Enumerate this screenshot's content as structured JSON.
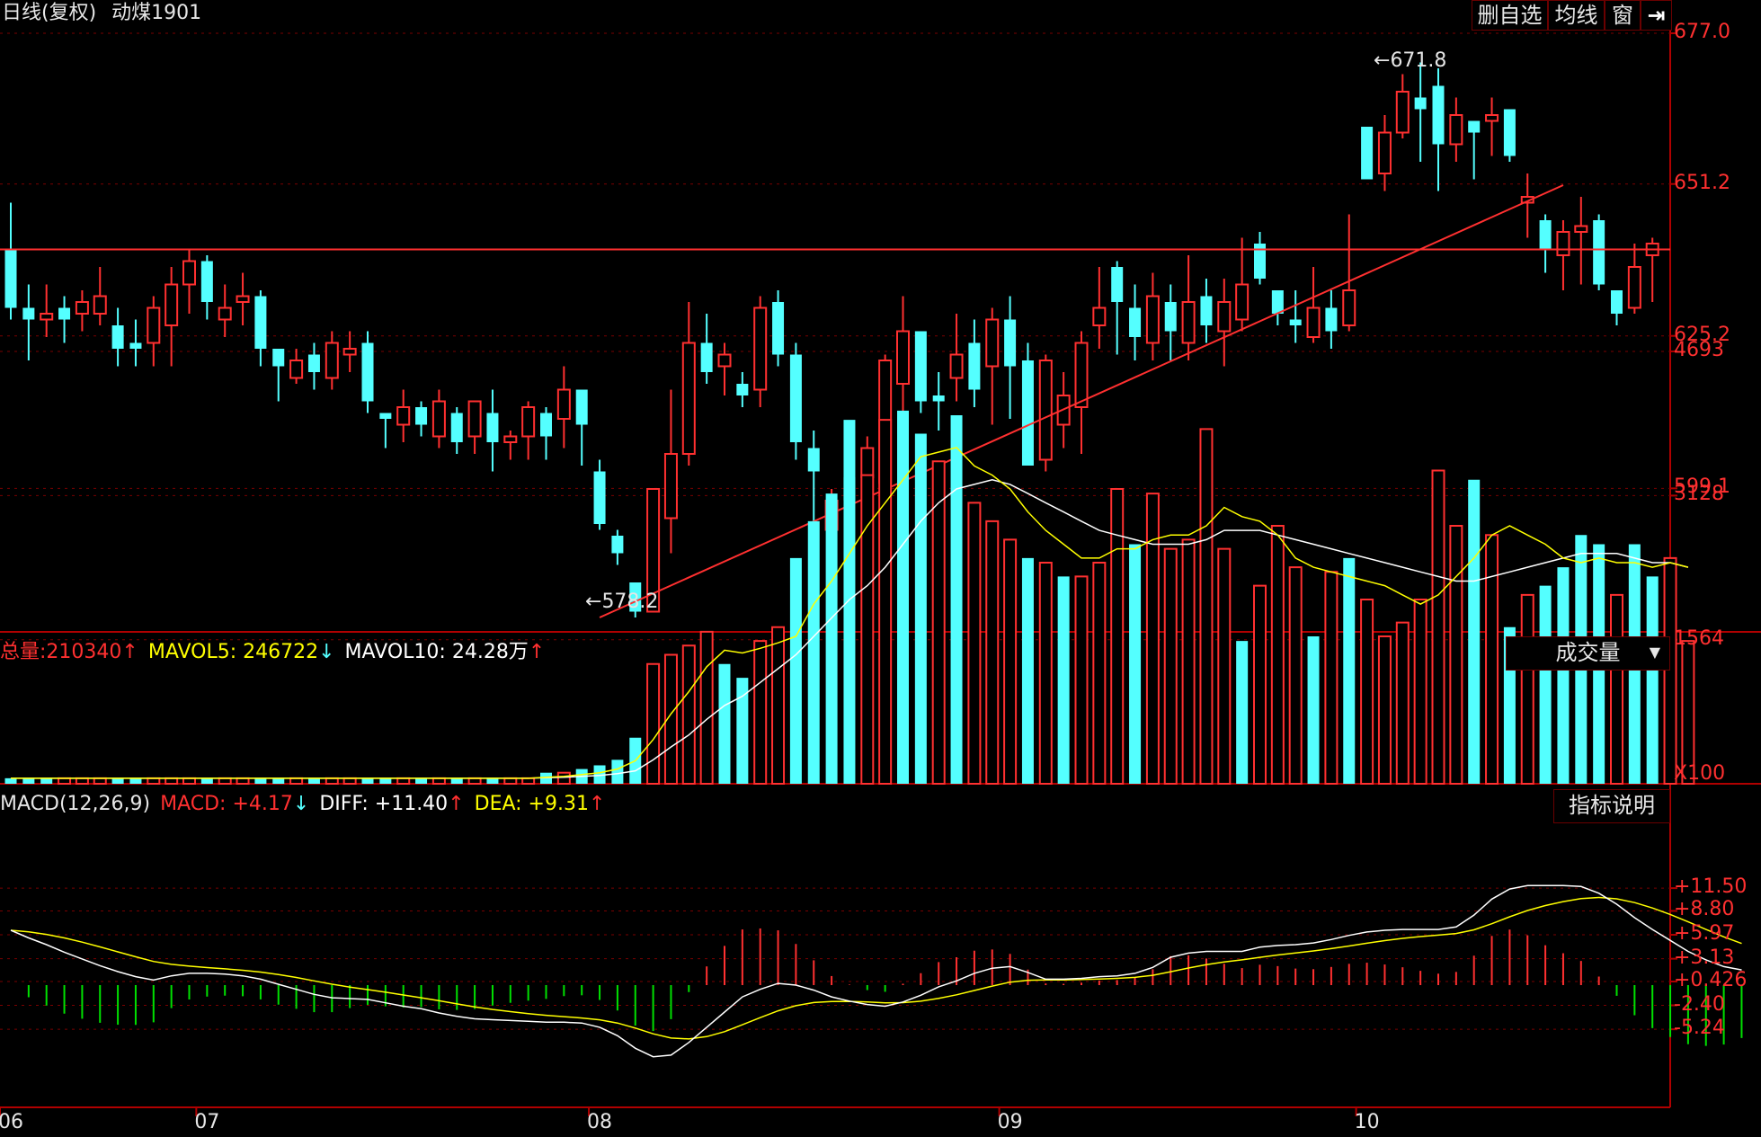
{
  "header": {
    "title": "日线(复权)",
    "symbol": "动煤1901",
    "buttons": [
      {
        "id": "delete-watchlist",
        "label": "删自选"
      },
      {
        "id": "moving-average",
        "label": "均线"
      },
      {
        "id": "window",
        "label": "窗"
      },
      {
        "id": "collapse",
        "label": "⇥"
      }
    ]
  },
  "colors": {
    "up": "#ff3030",
    "down": "#54ffff",
    "grid": "#7a0000",
    "axis": "#b00000",
    "ma5": "#ffff00",
    "ma10": "#ffffff",
    "dea": "#ffff00",
    "diff": "#ffffff",
    "macd_pos": "#ff3030",
    "macd_neg": "#00e000",
    "text": "#e6e6e6"
  },
  "price_panel": {
    "y_ticks": [
      "677.0",
      "651.2",
      "625.2",
      "599.1"
    ],
    "high_label": "671.8",
    "low_label": "578.2",
    "horizontal_line_price": 640,
    "trendline": {
      "from": {
        "index": 33,
        "price": 577
      },
      "to": {
        "index": 87,
        "price": 651
      }
    }
  },
  "volume_panel": {
    "legend": {
      "total_label": "总量:",
      "total": "210340",
      "ma5_label": "MAVOL5:",
      "ma5": "246722",
      "ma10_label": "MAVOL10:",
      "ma10": "24.28万"
    },
    "selector": "成交量",
    "y_ticks": [
      "4693",
      "3128",
      "1564"
    ],
    "unit": "X100"
  },
  "macd_panel": {
    "legend": {
      "name": "MACD(12,26,9)",
      "macd_label": "MACD:",
      "macd": "+4.17",
      "diff_label": "DIFF:",
      "diff": "+11.40",
      "dea_label": "DEA:",
      "dea": "+9.31"
    },
    "help_button": "指标说明",
    "y_ticks": [
      "+11.50",
      "+8.80",
      "+5.97",
      "+3.13",
      "+0.426",
      "-2.40",
      "-5.24"
    ]
  },
  "x_axis": {
    "labels": [
      {
        "text": "06",
        "index": 0
      },
      {
        "text": "07",
        "index": 11
      },
      {
        "text": "08",
        "index": 33
      },
      {
        "text": "09",
        "index": 56
      },
      {
        "text": "10",
        "index": 76
      }
    ]
  },
  "chart_data": {
    "type": "candlestick",
    "candles": [
      [
        640,
        630,
        648,
        628
      ],
      [
        630,
        628,
        634,
        621
      ],
      [
        628,
        629,
        634,
        625
      ],
      [
        630,
        628,
        632,
        624
      ],
      [
        629,
        631,
        633,
        626
      ],
      [
        629,
        632,
        637,
        627
      ],
      [
        627,
        623,
        630,
        620
      ],
      [
        624,
        623,
        628,
        620
      ],
      [
        624,
        630,
        632,
        620
      ],
      [
        627,
        634,
        637,
        620
      ],
      [
        634,
        638,
        640,
        629
      ],
      [
        638,
        631,
        639,
        628
      ],
      [
        628,
        630,
        634,
        625
      ],
      [
        631,
        632,
        636,
        627
      ],
      [
        632,
        623,
        633,
        620
      ],
      [
        623,
        620,
        623,
        614
      ],
      [
        618,
        621,
        623,
        617
      ],
      [
        622,
        619,
        624,
        616
      ],
      [
        618,
        624,
        626,
        616
      ],
      [
        622,
        623,
        626,
        619
      ],
      [
        624,
        614,
        626,
        612
      ],
      [
        612,
        611,
        612,
        606
      ],
      [
        610,
        613,
        616,
        607
      ],
      [
        613,
        610,
        614,
        608
      ],
      [
        608,
        614,
        616,
        606
      ],
      [
        612,
        607,
        613,
        605
      ],
      [
        608,
        614,
        614,
        605
      ],
      [
        612,
        607,
        616,
        602
      ],
      [
        607,
        608,
        609,
        604
      ],
      [
        608,
        613,
        614,
        604
      ],
      [
        612,
        608,
        613,
        604
      ],
      [
        611,
        616,
        620,
        606
      ],
      [
        616,
        610,
        616,
        603
      ],
      [
        602,
        593,
        604,
        592
      ],
      [
        591,
        588,
        592,
        586
      ],
      [
        583,
        578,
        583,
        577
      ],
      [
        578,
        599,
        599,
        578
      ],
      [
        594,
        605,
        616,
        588
      ],
      [
        605,
        624,
        631,
        603
      ],
      [
        624,
        619,
        629,
        617
      ],
      [
        620,
        622,
        624,
        615
      ],
      [
        617,
        615,
        619,
        613
      ],
      [
        616,
        630,
        632,
        613
      ],
      [
        631,
        622,
        633,
        620
      ],
      [
        622,
        607,
        624,
        604
      ],
      [
        606,
        602,
        609,
        590
      ],
      [
        592,
        597,
        599,
        590
      ],
      [
        601,
        597,
        604,
        584
      ],
      [
        601,
        606,
        608,
        599
      ],
      [
        600,
        621,
        622,
        595
      ],
      [
        617,
        626,
        632,
        609
      ],
      [
        626,
        614,
        626,
        612
      ],
      [
        615,
        614,
        619,
        609
      ],
      [
        618,
        622,
        629,
        614
      ],
      [
        624,
        616,
        628,
        613
      ],
      [
        620,
        628,
        630,
        610
      ],
      [
        628,
        620,
        632,
        611
      ],
      [
        621,
        603,
        624,
        603
      ],
      [
        604,
        621,
        622,
        602
      ],
      [
        610,
        615,
        619,
        606
      ],
      [
        613,
        624,
        626,
        605
      ],
      [
        627,
        630,
        637,
        623
      ],
      [
        637,
        631,
        638,
        622
      ],
      [
        630,
        625,
        634,
        621
      ],
      [
        624,
        632,
        636,
        621
      ],
      [
        631,
        626,
        634,
        621
      ],
      [
        624,
        631,
        639,
        621
      ],
      [
        632,
        627,
        635,
        624
      ],
      [
        626,
        631,
        635,
        620
      ],
      [
        628,
        634,
        642,
        626
      ],
      [
        641,
        635,
        643,
        634
      ],
      [
        633,
        629,
        633,
        627
      ],
      [
        628,
        627,
        633,
        624
      ],
      [
        625,
        630,
        637,
        624
      ],
      [
        630,
        626,
        633,
        623
      ],
      [
        627,
        633,
        646,
        626
      ],
      [
        661,
        652,
        656,
        655
      ],
      [
        653,
        660,
        663,
        650
      ],
      [
        660,
        667,
        670,
        659
      ],
      [
        666,
        664,
        672,
        655
      ],
      [
        668,
        658,
        671,
        650
      ],
      [
        658,
        663,
        666,
        655
      ],
      [
        662,
        660,
        661,
        652
      ],
      [
        662,
        663,
        666,
        656
      ],
      [
        664,
        656,
        664,
        655
      ],
      [
        648,
        649,
        653,
        642
      ],
      [
        645,
        640,
        646,
        636
      ],
      [
        639,
        643,
        645,
        633
      ],
      [
        643,
        644,
        649,
        634
      ],
      [
        645,
        634,
        646,
        633
      ],
      [
        633,
        629,
        631,
        627
      ],
      [
        630,
        637,
        641,
        629
      ],
      [
        639,
        641,
        642,
        631
      ]
    ],
    "volume": [
      {
        "v": 60,
        "up": false
      },
      {
        "v": 60,
        "up": false
      },
      {
        "v": 60,
        "up": false
      },
      {
        "v": 60,
        "up": true
      },
      {
        "v": 60,
        "up": true
      },
      {
        "v": 60,
        "up": true
      },
      {
        "v": 60,
        "up": false
      },
      {
        "v": 60,
        "up": false
      },
      {
        "v": 60,
        "up": true
      },
      {
        "v": 60,
        "up": true
      },
      {
        "v": 60,
        "up": true
      },
      {
        "v": 60,
        "up": false
      },
      {
        "v": 60,
        "up": true
      },
      {
        "v": 60,
        "up": true
      },
      {
        "v": 60,
        "up": false
      },
      {
        "v": 60,
        "up": false
      },
      {
        "v": 60,
        "up": true
      },
      {
        "v": 60,
        "up": false
      },
      {
        "v": 60,
        "up": true
      },
      {
        "v": 60,
        "up": true
      },
      {
        "v": 60,
        "up": false
      },
      {
        "v": 60,
        "up": false
      },
      {
        "v": 60,
        "up": true
      },
      {
        "v": 60,
        "up": false
      },
      {
        "v": 60,
        "up": true
      },
      {
        "v": 60,
        "up": false
      },
      {
        "v": 60,
        "up": true
      },
      {
        "v": 60,
        "up": false
      },
      {
        "v": 60,
        "up": true
      },
      {
        "v": 60,
        "up": true
      },
      {
        "v": 120,
        "up": false
      },
      {
        "v": 120,
        "up": true
      },
      {
        "v": 160,
        "up": false
      },
      {
        "v": 200,
        "up": false
      },
      {
        "v": 260,
        "up": false
      },
      {
        "v": 500,
        "up": false
      },
      {
        "v": 1300,
        "up": true
      },
      {
        "v": 1400,
        "up": true
      },
      {
        "v": 1500,
        "up": true
      },
      {
        "v": 1650,
        "up": true
      },
      {
        "v": 1300,
        "up": false
      },
      {
        "v": 1150,
        "up": false
      },
      {
        "v": 1550,
        "up": true
      },
      {
        "v": 1700,
        "up": true
      },
      {
        "v": 2450,
        "up": false
      },
      {
        "v": 2850,
        "up": false
      },
      {
        "v": 3150,
        "up": false
      },
      {
        "v": 3950,
        "up": false
      },
      {
        "v": 3350,
        "up": true
      },
      {
        "v": 3950,
        "up": true
      },
      {
        "v": 4050,
        "up": false
      },
      {
        "v": 3800,
        "up": false
      },
      {
        "v": 3500,
        "up": true
      },
      {
        "v": 4000,
        "up": false
      },
      {
        "v": 3050,
        "up": true
      },
      {
        "v": 2850,
        "up": true
      },
      {
        "v": 2650,
        "up": true
      },
      {
        "v": 2450,
        "up": false
      },
      {
        "v": 2400,
        "up": true
      },
      {
        "v": 2250,
        "up": false
      },
      {
        "v": 2250,
        "up": true
      },
      {
        "v": 2400,
        "up": true
      },
      {
        "v": 3200,
        "up": true
      },
      {
        "v": 2600,
        "up": false
      },
      {
        "v": 3150,
        "up": true
      },
      {
        "v": 2550,
        "up": true
      },
      {
        "v": 2650,
        "up": true
      },
      {
        "v": 3850,
        "up": true
      },
      {
        "v": 2550,
        "up": true
      },
      {
        "v": 1550,
        "up": false
      },
      {
        "v": 2150,
        "up": true
      },
      {
        "v": 2800,
        "up": true
      },
      {
        "v": 2350,
        "up": true
      },
      {
        "v": 1600,
        "up": false
      },
      {
        "v": 2300,
        "up": true
      },
      {
        "v": 2450,
        "up": false
      },
      {
        "v": 2000,
        "up": true
      },
      {
        "v": 1600,
        "up": true
      },
      {
        "v": 1750,
        "up": true
      },
      {
        "v": 2000,
        "up": true
      },
      {
        "v": 3400,
        "up": true
      },
      {
        "v": 2800,
        "up": true
      },
      {
        "v": 3300,
        "up": false
      },
      {
        "v": 2700,
        "up": true
      },
      {
        "v": 1700,
        "up": false
      },
      {
        "v": 2050,
        "up": true
      },
      {
        "v": 2150,
        "up": false
      },
      {
        "v": 2350,
        "up": false
      },
      {
        "v": 2700,
        "up": false
      },
      {
        "v": 2600,
        "up": false
      },
      {
        "v": 2050,
        "up": true
      },
      {
        "v": 2600,
        "up": false
      },
      {
        "v": 2250,
        "up": false
      },
      {
        "v": 2450,
        "up": true
      },
      {
        "v": 1550,
        "up": true
      }
    ],
    "mavol5": [
      60,
      60,
      60,
      60,
      60,
      60,
      60,
      60,
      60,
      60,
      60,
      60,
      60,
      60,
      60,
      60,
      60,
      60,
      60,
      60,
      60,
      60,
      60,
      60,
      60,
      60,
      60,
      60,
      60,
      60,
      70,
      80,
      100,
      120,
      160,
      250,
      480,
      760,
      1000,
      1270,
      1450,
      1420,
      1470,
      1530,
      1600,
      1950,
      2200,
      2500,
      2800,
      3050,
      3300,
      3550,
      3600,
      3650,
      3450,
      3350,
      3200,
      2950,
      2750,
      2600,
      2450,
      2450,
      2550,
      2550,
      2650,
      2700,
      2700,
      2800,
      3000,
      2900,
      2850,
      2700,
      2450,
      2350,
      2300,
      2250,
      2200,
      2150,
      2050,
      1950,
      2050,
      2250,
      2450,
      2700,
      2800,
      2700,
      2600,
      2450,
      2400,
      2450,
      2400,
      2400,
      2350,
      2400,
      2350
    ],
    "mavol10": [
      60,
      60,
      60,
      60,
      60,
      60,
      60,
      60,
      60,
      60,
      60,
      60,
      60,
      60,
      60,
      60,
      60,
      60,
      60,
      60,
      60,
      60,
      60,
      60,
      60,
      60,
      60,
      60,
      60,
      60,
      65,
      70,
      80,
      90,
      110,
      140,
      260,
      400,
      530,
      700,
      850,
      950,
      1100,
      1250,
      1400,
      1600,
      1800,
      2000,
      2150,
      2350,
      2600,
      2850,
      3050,
      3200,
      3250,
      3300,
      3250,
      3150,
      3050,
      2950,
      2850,
      2750,
      2700,
      2650,
      2600,
      2600,
      2600,
      2650,
      2750,
      2750,
      2750,
      2700,
      2650,
      2600,
      2550,
      2500,
      2450,
      2400,
      2350,
      2300,
      2250,
      2200,
      2200,
      2250,
      2300,
      2350,
      2400,
      2450,
      2500,
      2500,
      2500,
      2450,
      2400,
      2400,
      2350
    ],
    "macd": {
      "diff": [
        6.5,
        5.6,
        4.8,
        3.9,
        3.1,
        2.3,
        1.6,
        1.0,
        0.6,
        1.1,
        1.4,
        1.4,
        1.3,
        1.1,
        0.7,
        0.1,
        -0.5,
        -1.1,
        -1.5,
        -1.6,
        -1.7,
        -2.1,
        -2.5,
        -2.8,
        -3.3,
        -3.7,
        -4.0,
        -4.1,
        -4.2,
        -4.3,
        -4.4,
        -4.4,
        -4.5,
        -5.0,
        -6.0,
        -7.5,
        -8.5,
        -8.3,
        -6.8,
        -5.0,
        -3.2,
        -1.4,
        -0.5,
        0.2,
        0.0,
        -0.6,
        -1.4,
        -1.9,
        -2.3,
        -2.5,
        -2.0,
        -1.2,
        -0.2,
        0.5,
        1.4,
        2.0,
        2.2,
        1.5,
        0.7,
        0.7,
        0.8,
        1.0,
        1.1,
        1.4,
        2.1,
        3.3,
        3.8,
        4.0,
        4.0,
        4.0,
        4.5,
        4.7,
        4.8,
        5.0,
        5.4,
        5.9,
        6.3,
        6.5,
        6.6,
        6.6,
        6.6,
        6.9,
        8.3,
        10.2,
        11.4,
        11.8,
        11.8,
        11.8,
        11.7,
        10.9,
        9.6,
        8.0,
        6.6,
        5.3,
        4.0,
        3.0,
        2.2,
        1.8
      ]
    }
  }
}
